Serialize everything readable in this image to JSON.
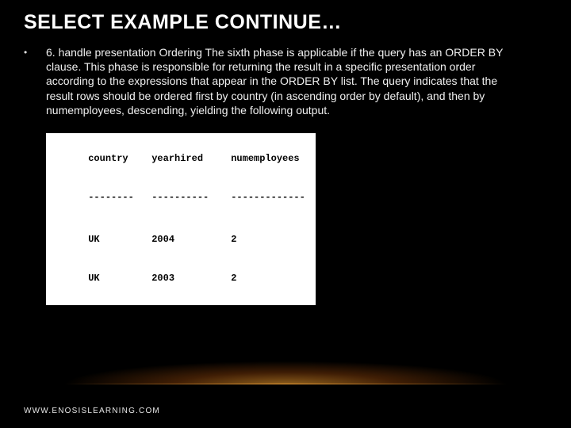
{
  "title": "SELECT EXAMPLE CONTINUE…",
  "bullet_glyph": "•",
  "body_text": "6. handle presentation Ordering The sixth phase is applicable if the query has an ORDER BY clause. This phase is responsible for returning the result in a specific presentation order according to the expressions that appear in the ORDER BY list. The query indicates that the result rows should be ordered first by country (in ascending order by default), and then by numemployees, descending, yielding the following output.",
  "table": {
    "headers": {
      "a": "country",
      "b": "yearhired",
      "c": "numemployees"
    },
    "divider": {
      "a": "--------",
      "b": "----------",
      "c": "-------------"
    },
    "rows": [
      {
        "a": "UK",
        "b": "2004",
        "c": "2"
      },
      {
        "a": "UK",
        "b": "2003",
        "c": "2"
      }
    ]
  },
  "footer": "WWW.ENOSISLEARNING.COM"
}
